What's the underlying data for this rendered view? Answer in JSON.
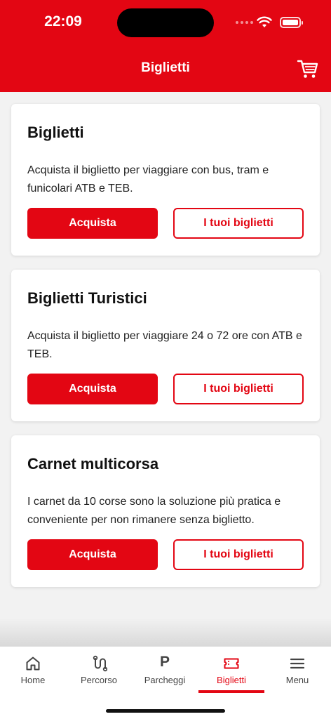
{
  "status_bar": {
    "time": "22:09"
  },
  "header": {
    "title": "Biglietti",
    "cart_icon": "cart-icon"
  },
  "cards": [
    {
      "title": "Biglietti",
      "description": "Acquista il biglietto per viaggiare con bus, tram e funicolari ATB e TEB.",
      "primary_label": "Acquista",
      "secondary_label": "I tuoi biglietti"
    },
    {
      "title": "Biglietti Turistici",
      "description": "Acquista il biglietto per viaggiare 24 o 72 ore con ATB e TEB.",
      "primary_label": "Acquista",
      "secondary_label": "I tuoi biglietti"
    },
    {
      "title": "Carnet multicorsa",
      "description": "I carnet da 10 corse sono la soluzione più pratica e conveniente per non rimanere senza biglietto.",
      "primary_label": "Acquista",
      "secondary_label": "I tuoi biglietti"
    }
  ],
  "tabbar": {
    "items": [
      {
        "label": "Home",
        "icon": "home-icon"
      },
      {
        "label": "Percorso",
        "icon": "route-icon"
      },
      {
        "label": "Parcheggi",
        "icon": "parking-icon",
        "glyph": "P"
      },
      {
        "label": "Biglietti",
        "icon": "ticket-icon",
        "active": true
      },
      {
        "label": "Menu",
        "icon": "menu-icon"
      }
    ]
  },
  "colors": {
    "brand": "#e30613",
    "background": "#f2f2f2",
    "text": "#111111"
  }
}
